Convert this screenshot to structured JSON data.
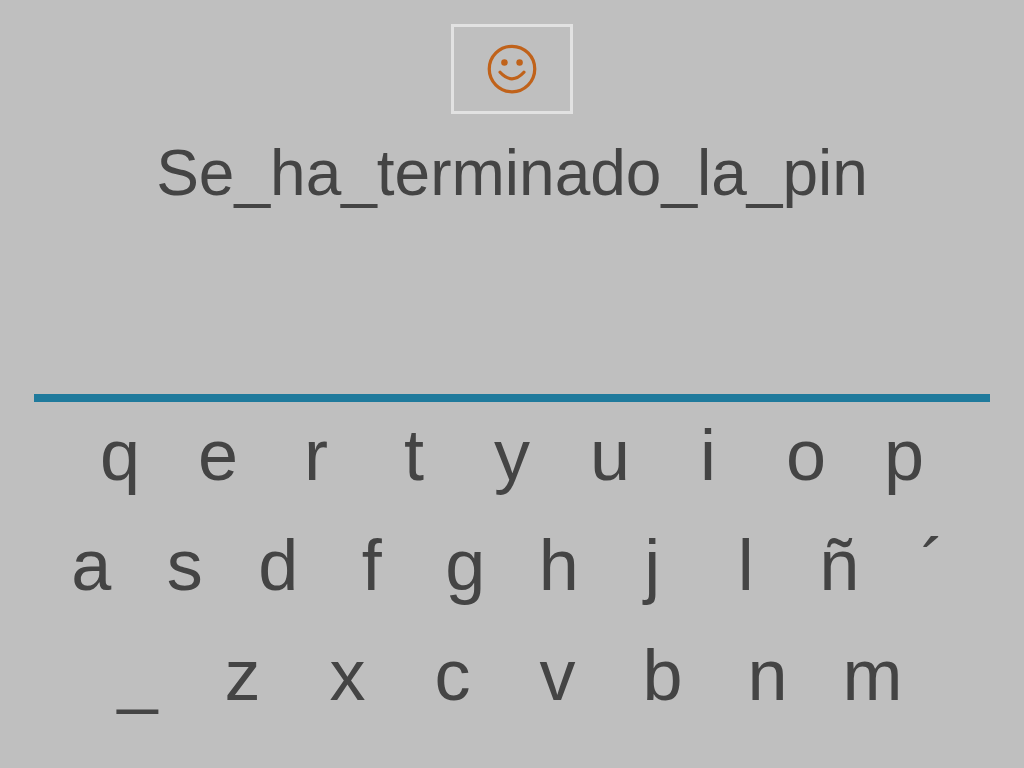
{
  "phrase": "Se_ha_terminado_la_pin",
  "keyboard": {
    "rows": [
      [
        "q",
        "e",
        "r",
        "t",
        "y",
        "u",
        "i",
        "o",
        "p"
      ],
      [
        "a",
        "s",
        "d",
        "f",
        "g",
        "h",
        "j",
        "l",
        "ñ",
        "´"
      ],
      [
        "_",
        "z",
        "x",
        "c",
        "v",
        "b",
        "n",
        "m"
      ]
    ]
  }
}
